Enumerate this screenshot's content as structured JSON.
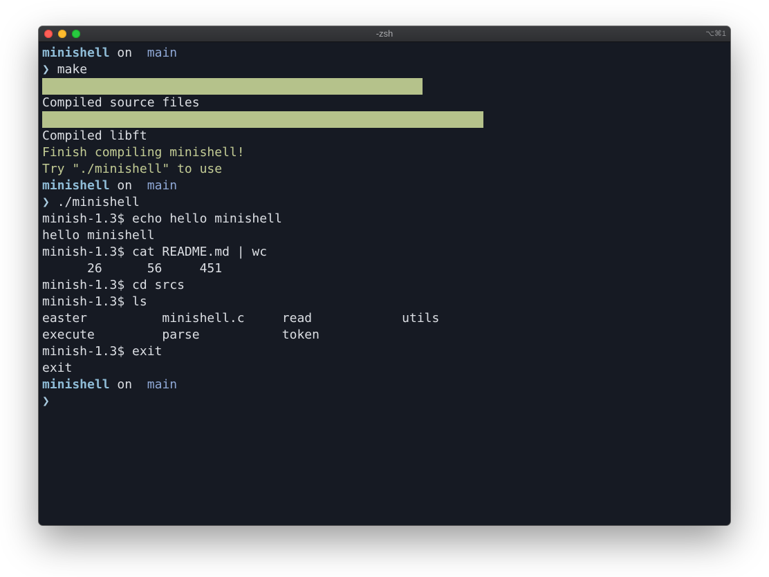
{
  "window": {
    "title": "-zsh",
    "shortcut": "⌥⌘1"
  },
  "prompt": {
    "repo": "minishell",
    "on": "on",
    "branch_icon": "",
    "branch": "main",
    "arrow": "❯"
  },
  "session": {
    "cmd_make": "make",
    "progress_bars": [
      {
        "name": "source-progress",
        "fill": 1.0
      },
      {
        "name": "libft-progress",
        "fill": 1.0
      }
    ],
    "compiled_source": "Compiled source files",
    "compiled_libft": "Compiled libft",
    "finish_msg": "Finish compiling minishell!",
    "try_msg": "Try \"./minishell\" to use",
    "cmd_run": "./minishell",
    "shell_lines": [
      "minish-1.3$ echo hello minishell",
      "hello minishell",
      "minish-1.3$ cat README.md | wc",
      "      26      56     451",
      "minish-1.3$ cd srcs",
      "minish-1.3$ ls",
      "easter          minishell.c     read            utils",
      "execute         parse           token",
      "minish-1.3$ exit",
      "exit"
    ]
  },
  "colors": {
    "background": "#161a23",
    "text": "#dcdfe4",
    "repo": "#8fbcd7",
    "branch": "#8fa8d6",
    "success": "#c3cc95",
    "progress": "#b5c28b"
  }
}
